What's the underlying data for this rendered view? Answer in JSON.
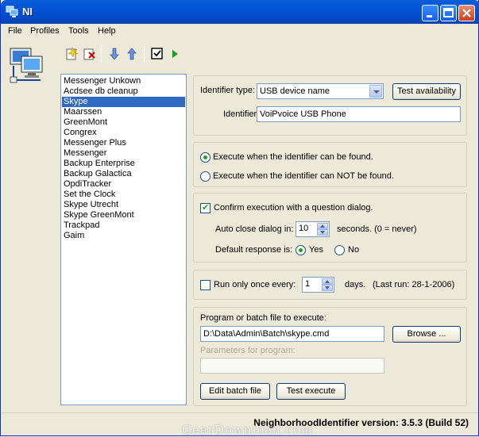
{
  "window": {
    "title": "NI"
  },
  "menu": [
    "File",
    "Profiles",
    "Tools",
    "Help"
  ],
  "toolbar": {
    "icons": [
      "new-profile-icon",
      "delete-profile-icon",
      "move-down-icon",
      "move-up-icon",
      "check-icon",
      "run-icon"
    ]
  },
  "profiles": {
    "items": [
      "Messenger Unkown",
      "Acdsee db cleanup",
      "Skype",
      "Maarssen",
      "GreenMont",
      "Congrex",
      "Messenger Plus",
      "Messenger",
      "Backup Enterprise",
      "Backup Galactica",
      "OpdiTracker",
      "Set the Clock",
      "Skype Utrecht",
      "Skype GreenMont",
      "Trackpad",
      "Gaim"
    ],
    "selected": "Skype"
  },
  "identifier": {
    "type_label": "Identifier type:",
    "type_value": "USB device name",
    "test_button": "Test availability",
    "label": "Identifier",
    "value": "VoiPvoice USB Phone"
  },
  "execute_when": {
    "found": "Execute when the identifier can be found.",
    "not_found": "Execute when the identifier can NOT be found.",
    "selected": "found"
  },
  "confirm": {
    "label": "Confirm execution with a question dialog.",
    "checked": true,
    "auto_close_label": "Auto close dialog in:",
    "auto_close_value": "10",
    "auto_close_suffix": "seconds. (0 = never)",
    "default_label": "Default response is:",
    "yes": "Yes",
    "no": "No",
    "default_selected": "yes"
  },
  "run_once": {
    "label": "Run only once every:",
    "checked": false,
    "value": "1",
    "suffix": "days.",
    "last_run": "(Last run: 28-1-2006)"
  },
  "program": {
    "label": "Program or batch file to execute:",
    "path": "D:\\Data\\Admin\\Batch\\skype.cmd",
    "browse_button": "Browse ...",
    "params_label": "Parameters for program:",
    "params_value": "",
    "edit_button": "Edit batch file",
    "test_button": "Test execute"
  },
  "version": "NeighborhoodIdentifier version: 3.5.3 (Build 52)",
  "watermark": "GearDownload.com"
}
